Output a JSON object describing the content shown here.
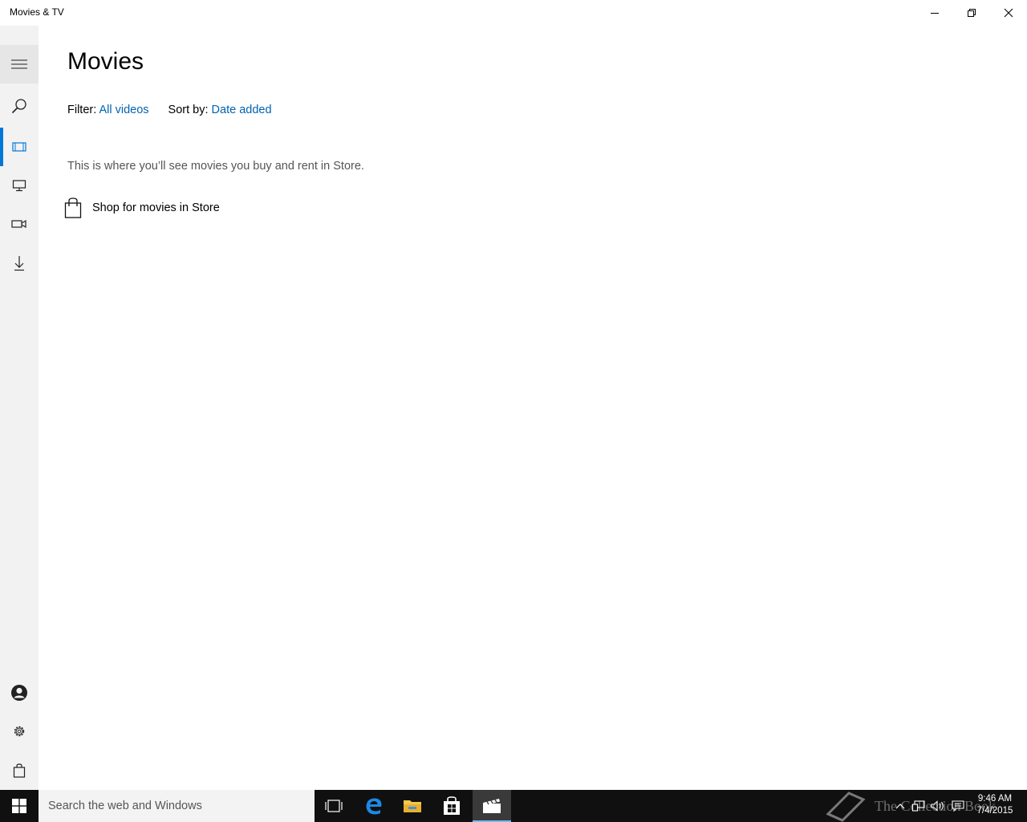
{
  "window": {
    "title": "Movies & TV",
    "controls": {
      "minimize": "minimize",
      "restore": "restore",
      "close": "close"
    }
  },
  "sidebar": {
    "items": [
      {
        "name": "menu",
        "icon": "hamburger-icon"
      },
      {
        "name": "search",
        "icon": "search-icon"
      },
      {
        "name": "movies",
        "icon": "film-icon",
        "active": true
      },
      {
        "name": "tv",
        "icon": "tv-icon"
      },
      {
        "name": "videos",
        "icon": "video-camera-icon"
      },
      {
        "name": "downloads",
        "icon": "download-icon"
      }
    ],
    "bottom_items": [
      {
        "name": "account",
        "icon": "account-icon"
      },
      {
        "name": "settings",
        "icon": "gear-icon"
      },
      {
        "name": "store",
        "icon": "shopping-bag-icon"
      }
    ]
  },
  "main": {
    "title": "Movies",
    "filter_label": "Filter:",
    "filter_value": "All videos",
    "sort_label": "Sort by:",
    "sort_value": "Date added",
    "empty_message": "This is where you’ll see movies you buy and rent in Store.",
    "shop_link": "Shop for movies in Store"
  },
  "taskbar": {
    "search_placeholder": "Search the web and Windows",
    "apps": [
      "task-view-icon",
      "edge-icon",
      "file-explorer-icon",
      "store-icon",
      "movies-tv-icon"
    ],
    "watermark": "The Collection Book",
    "clock_time": "9:46 AM",
    "clock_date": "7/4/2015"
  },
  "colors": {
    "accent": "#0078d7",
    "link": "#0063b1",
    "sidebar_bg": "#f2f2f2",
    "taskbar_bg": "#101010"
  }
}
